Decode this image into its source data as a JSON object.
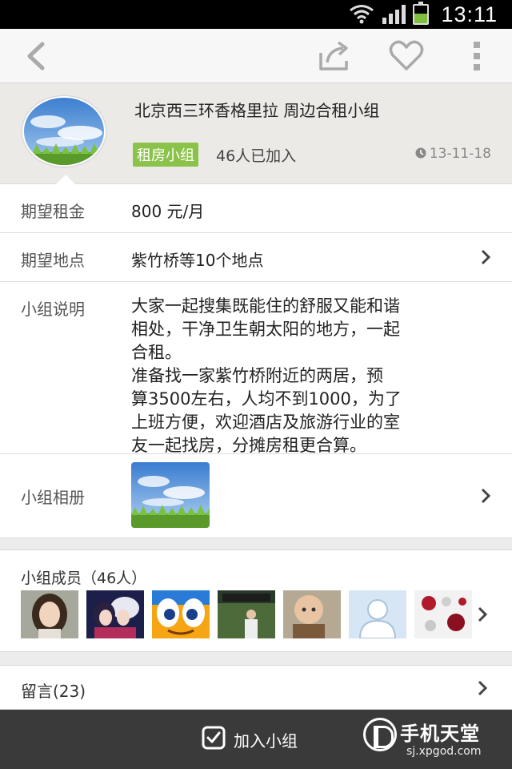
{
  "status_bar": {
    "time": "13:11",
    "wifi_icon": "wifi-icon",
    "signal_icon": "signal-icon",
    "battery_icon": "battery-icon"
  },
  "action_bar": {
    "back_icon": "chevron-left-icon",
    "share_icon": "share-icon",
    "favorite_icon": "heart-icon",
    "more_icon": "more-vertical-icon"
  },
  "group": {
    "title": "北京西三环香格里拉 周边合租小组",
    "tag": "租房小组",
    "joined": "46人已加入",
    "date": "13-11-18",
    "tag_color": "#8bc34a"
  },
  "details": {
    "rent": {
      "label": "期望租金",
      "value": "800 元/月"
    },
    "place": {
      "label": "期望地点",
      "value": "紫竹桥等10个地点"
    },
    "desc": {
      "label": "小组说明",
      "lines": [
        "大家一起搜集既能住的舒服又能和谐",
        "相处，干净卫生朝太阳的地方，一起",
        "合租。",
        "准备找一家紫竹桥附近的两居，预",
        "算3500左右，人均不到1000，为了",
        "上班方便，欢迎酒店及旅游行业的室",
        "友一起找房，分摊房租更合算。"
      ]
    },
    "album": {
      "label": "小组相册"
    }
  },
  "members": {
    "title": "小组成员（46人）"
  },
  "comments": {
    "label": "留言(23)"
  },
  "join": {
    "label": "加入小组"
  },
  "watermark": {
    "name": "手机天堂",
    "url": "sj.xpgod.com"
  }
}
